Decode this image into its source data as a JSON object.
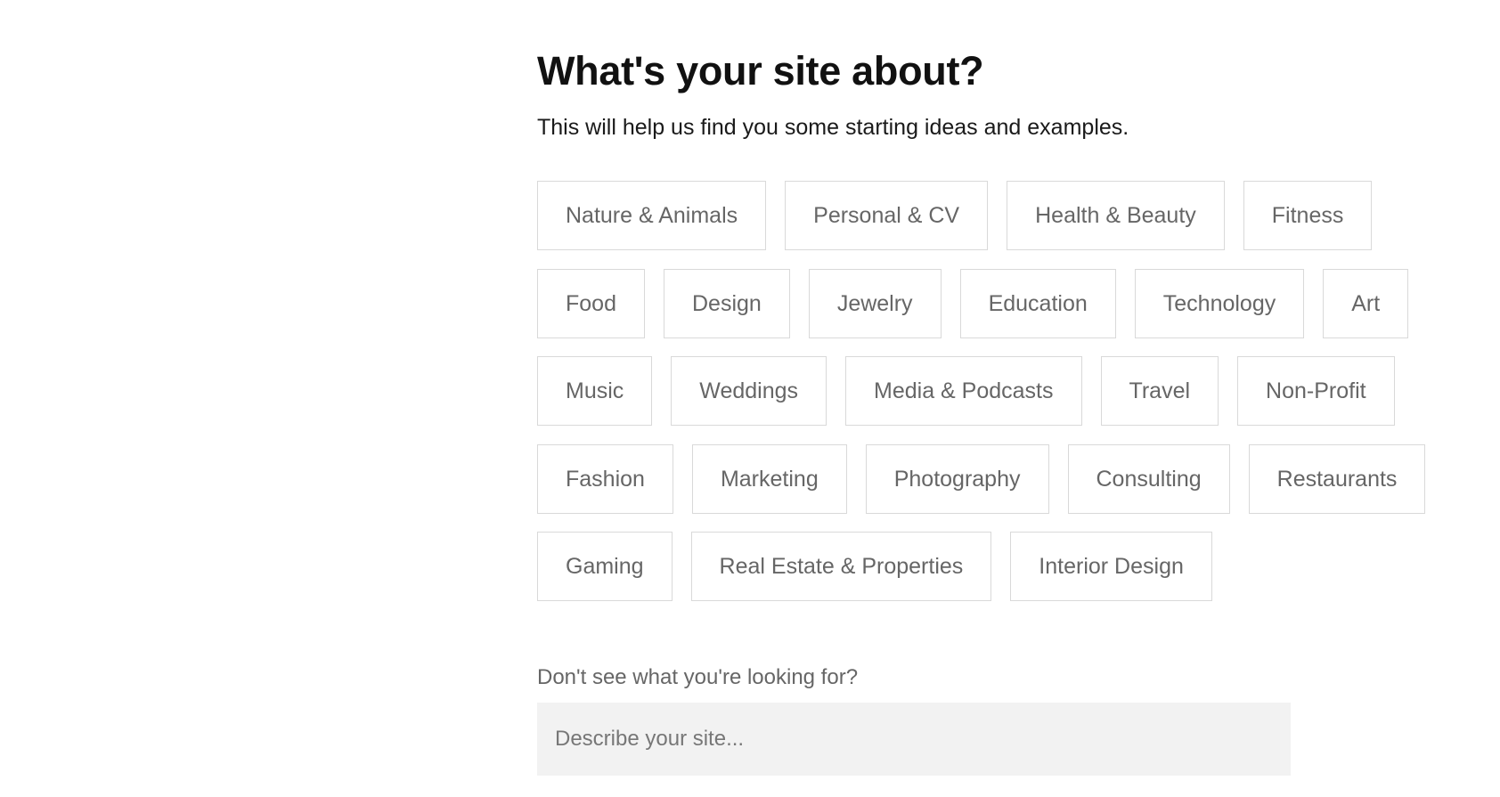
{
  "header": {
    "title": "What's your site about?",
    "subtitle": "This will help us find you some starting ideas and examples."
  },
  "categories": {
    "rows": [
      [
        "Nature & Animals",
        "Personal & CV",
        "Health & Beauty",
        "Fitness"
      ],
      [
        "Food",
        "Design",
        "Jewelry",
        "Education",
        "Technology",
        "Art"
      ],
      [
        "Music",
        "Weddings",
        "Media & Podcasts",
        "Travel",
        "Non-Profit"
      ],
      [
        "Fashion",
        "Marketing",
        "Photography",
        "Consulting",
        "Restaurants"
      ],
      [
        "Gaming",
        "Real Estate & Properties",
        "Interior Design"
      ]
    ]
  },
  "custom": {
    "label": "Don't see what you're looking for?",
    "placeholder": "Describe your site...",
    "value": ""
  },
  "colors": {
    "chip_border": "#d9d9d9",
    "chip_text": "#666666",
    "input_background": "#f2f2f2",
    "title_text": "#111111"
  }
}
